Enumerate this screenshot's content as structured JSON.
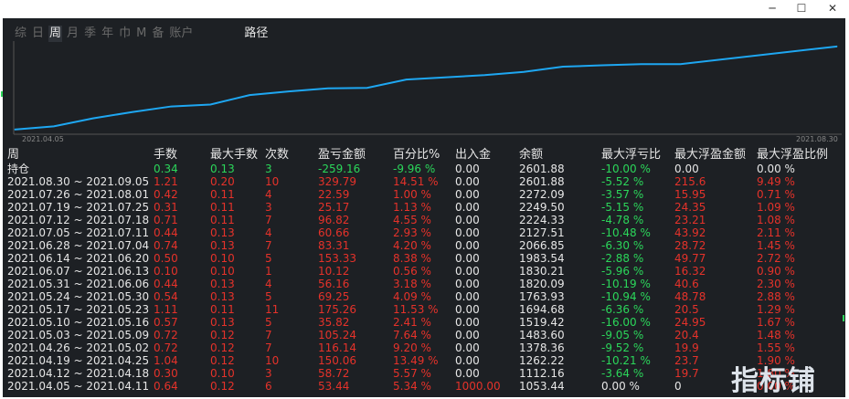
{
  "window": {
    "minimize": "─",
    "restore": "☐",
    "close": "✕"
  },
  "tabs": [
    {
      "label": "综",
      "active": false
    },
    {
      "label": "日",
      "active": false
    },
    {
      "label": "周",
      "active": true
    },
    {
      "label": "月",
      "active": false
    },
    {
      "label": "季",
      "active": false
    },
    {
      "label": "年",
      "active": false
    },
    {
      "label": "巾",
      "active": false
    },
    {
      "label": "M",
      "active": false
    },
    {
      "label": "备",
      "active": false
    },
    {
      "label": "账户",
      "active": false
    }
  ],
  "path_tab": "路径",
  "chart": {
    "x_start": "2021.04.05",
    "x_end": "2021.08.30",
    "line_color": "#1ea7f2"
  },
  "chart_data": {
    "type": "line",
    "x": [
      "2021.04.05",
      "2021.04.12",
      "2021.04.19",
      "2021.04.26",
      "2021.05.03",
      "2021.05.10",
      "2021.05.17",
      "2021.05.24",
      "2021.05.31",
      "2021.06.07",
      "2021.06.14",
      "2021.06.28",
      "2021.07.05",
      "2021.07.12",
      "2021.07.19",
      "2021.07.26",
      "2021.08.02",
      "2021.08.30"
    ],
    "series": [
      {
        "values": [
          1053.44,
          1112.16,
          1262.22,
          1378.36,
          1483.6,
          1519.42,
          1694.68,
          1763.93,
          1820.09,
          1830.21,
          1983.54,
          2066.85,
          2127.51,
          2224.33,
          2249.5,
          2272.09,
          2272.09,
          2601.88
        ]
      }
    ],
    "ylim": [
      1000,
      2650
    ]
  },
  "table": {
    "headers": [
      "周",
      "手数",
      "最大手数",
      "次数",
      "盈亏金额",
      "百分比%",
      "出入金",
      "余额",
      "最大浮亏比",
      "最大浮盈金额",
      "最大浮盈比例"
    ],
    "holding": {
      "label": "持仓",
      "lots": "0.34",
      "max_lots": "0.13",
      "count": "3",
      "pnl": "-259.16",
      "pct": "-9.96 %",
      "inout": "0.00",
      "balance": "2601.88",
      "max_float_loss": "-10.00 %",
      "max_float_profit_amt": "0.00",
      "max_float_profit_pct": "0.00 %"
    },
    "rows": [
      {
        "period": "2021.08.30 ~ 2021.09.05",
        "lots": "1.21",
        "max_lots": "0.20",
        "count": "10",
        "pnl": "329.79",
        "pct": "14.51 %",
        "inout": "0.00",
        "balance": "2601.88",
        "mfl": "-5.52 %",
        "mfpa": "215.6",
        "mfpp": "9.49 %"
      },
      {
        "period": "2021.07.26 ~ 2021.08.01",
        "lots": "0.42",
        "max_lots": "0.11",
        "count": "4",
        "pnl": "22.59",
        "pct": "1.00 %",
        "inout": "0.00",
        "balance": "2272.09",
        "mfl": "-3.57 %",
        "mfpa": "15.95",
        "mfpp": "0.71 %"
      },
      {
        "period": "2021.07.19 ~ 2021.07.25",
        "lots": "0.31",
        "max_lots": "0.11",
        "count": "3",
        "pnl": "25.17",
        "pct": "1.13 %",
        "inout": "0.00",
        "balance": "2249.50",
        "mfl": "-5.15 %",
        "mfpa": "24.35",
        "mfpp": "1.09 %"
      },
      {
        "period": "2021.07.12 ~ 2021.07.18",
        "lots": "0.71",
        "max_lots": "0.11",
        "count": "7",
        "pnl": "96.82",
        "pct": "4.55 %",
        "inout": "0.00",
        "balance": "2224.33",
        "mfl": "-4.78 %",
        "mfpa": "23.21",
        "mfpp": "1.08 %"
      },
      {
        "period": "2021.07.05 ~ 2021.07.11",
        "lots": "0.44",
        "max_lots": "0.13",
        "count": "4",
        "pnl": "60.66",
        "pct": "2.93 %",
        "inout": "0.00",
        "balance": "2127.51",
        "mfl": "-10.48 %",
        "mfpa": "43.92",
        "mfpp": "2.11 %"
      },
      {
        "period": "2021.06.28 ~ 2021.07.04",
        "lots": "0.74",
        "max_lots": "0.13",
        "count": "7",
        "pnl": "83.31",
        "pct": "4.20 %",
        "inout": "0.00",
        "balance": "2066.85",
        "mfl": "-6.30 %",
        "mfpa": "28.72",
        "mfpp": "1.45 %"
      },
      {
        "period": "2021.06.14 ~ 2021.06.20",
        "lots": "0.50",
        "max_lots": "0.10",
        "count": "5",
        "pnl": "153.33",
        "pct": "8.38 %",
        "inout": "0.00",
        "balance": "1983.54",
        "mfl": "-2.88 %",
        "mfpa": "49.77",
        "mfpp": "2.72 %"
      },
      {
        "period": "2021.06.07 ~ 2021.06.13",
        "lots": "0.10",
        "max_lots": "0.10",
        "count": "1",
        "pnl": "10.12",
        "pct": "0.56 %",
        "inout": "0.00",
        "balance": "1830.21",
        "mfl": "-5.96 %",
        "mfpa": "16.32",
        "mfpp": "0.90 %"
      },
      {
        "period": "2021.05.31 ~ 2021.06.06",
        "lots": "0.44",
        "max_lots": "0.13",
        "count": "4",
        "pnl": "56.16",
        "pct": "3.18 %",
        "inout": "0.00",
        "balance": "1820.09",
        "mfl": "-10.19 %",
        "mfpa": "40.6",
        "mfpp": "2.30 %"
      },
      {
        "period": "2021.05.24 ~ 2021.05.30",
        "lots": "0.54",
        "max_lots": "0.13",
        "count": "5",
        "pnl": "69.25",
        "pct": "4.09 %",
        "inout": "0.00",
        "balance": "1763.93",
        "mfl": "-10.94 %",
        "mfpa": "48.78",
        "mfpp": "2.88 %"
      },
      {
        "period": "2021.05.17 ~ 2021.05.23",
        "lots": "1.11",
        "max_lots": "0.11",
        "count": "11",
        "pnl": "175.26",
        "pct": "11.53 %",
        "inout": "0.00",
        "balance": "1694.68",
        "mfl": "-6.36 %",
        "mfpa": "20.5",
        "mfpp": "1.29 %"
      },
      {
        "period": "2021.05.10 ~ 2021.05.16",
        "lots": "0.57",
        "max_lots": "0.13",
        "count": "5",
        "pnl": "35.82",
        "pct": "2.41 %",
        "inout": "0.00",
        "balance": "1519.42",
        "mfl": "-16.00 %",
        "mfpa": "24.95",
        "mfpp": "1.67 %"
      },
      {
        "period": "2021.05.03 ~ 2021.05.09",
        "lots": "0.72",
        "max_lots": "0.12",
        "count": "7",
        "pnl": "105.24",
        "pct": "7.64 %",
        "inout": "0.00",
        "balance": "1483.60",
        "mfl": "-9.05 %",
        "mfpa": "20.4",
        "mfpp": "1.48 %"
      },
      {
        "period": "2021.04.26 ~ 2021.05.02",
        "lots": "0.72",
        "max_lots": "0.12",
        "count": "7",
        "pnl": "116.14",
        "pct": "9.20 %",
        "inout": "0.00",
        "balance": "1378.36",
        "mfl": "-9.52 %",
        "mfpa": "19.9",
        "mfpp": "1.55 %"
      },
      {
        "period": "2021.04.19 ~ 2021.04.25",
        "lots": "1.04",
        "max_lots": "0.12",
        "count": "10",
        "pnl": "150.06",
        "pct": "13.49 %",
        "inout": "0.00",
        "balance": "1262.22",
        "mfl": "-10.21 %",
        "mfpa": "23.7",
        "mfpp": "1.90 %"
      },
      {
        "period": "2021.04.12 ~ 2021.04.18",
        "lots": "0.30",
        "max_lots": "0.10",
        "count": "3",
        "pnl": "58.72",
        "pct": "5.57 %",
        "inout": "0.00",
        "balance": "1112.16",
        "mfl": "-3.64 %",
        "mfpa": "19.7",
        "mfpp": "1.80 %"
      },
      {
        "period": "2021.04.05 ~ 2021.04.11",
        "lots": "0.64",
        "max_lots": "0.12",
        "count": "6",
        "pnl": "53.44",
        "pct": "5.34 %",
        "inout": "1000.00",
        "balance": "1053.44",
        "mfl": "0.00 %",
        "mfpa": "0",
        "mfpp": "0.00 %"
      }
    ]
  },
  "watermark": "指标铺"
}
